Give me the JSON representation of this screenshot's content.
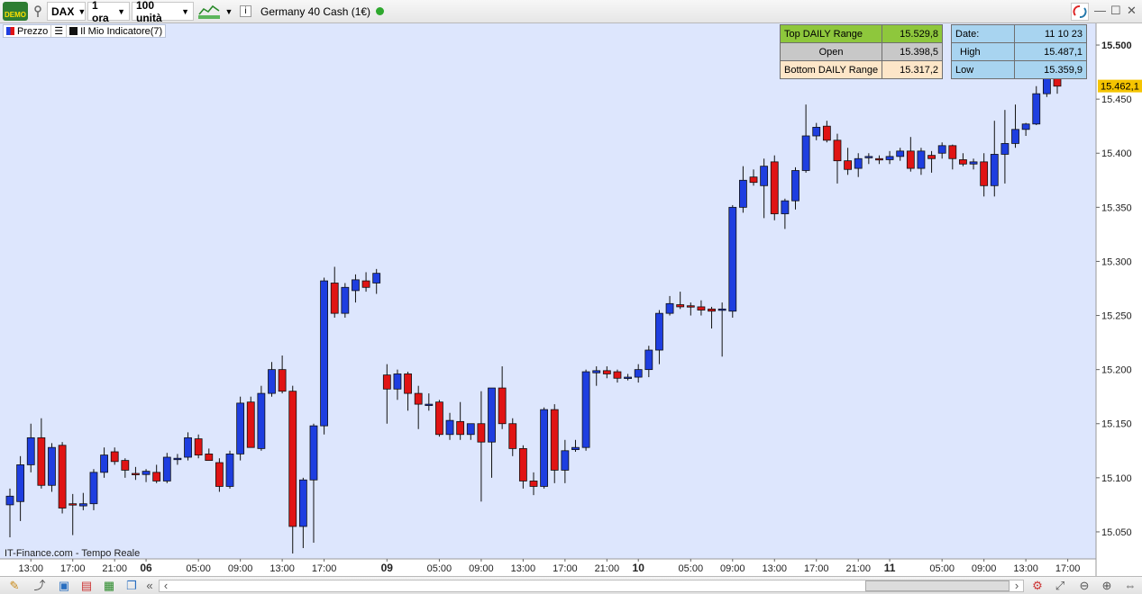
{
  "toolbar": {
    "demo_label": "DEMO",
    "symbol": "DAX",
    "timeframe": "1 ora",
    "units": "100 unità",
    "instrument": "Germany 40 Cash (1€)",
    "info_icon": "i"
  },
  "legend": {
    "price_label": "Prezzo",
    "indicator_label": "Il Mio Indicatore(7)"
  },
  "range_box": {
    "rows": [
      {
        "label": "Top DAILY Range",
        "value": "15.529,8"
      },
      {
        "label": "Open",
        "value": "15.398,5"
      },
      {
        "label": "Bottom DAILY Range",
        "value": "15.317,2"
      }
    ]
  },
  "stats_box": {
    "rows": [
      {
        "label": "Date:",
        "value": "11 10 23"
      },
      {
        "label": "High",
        "value": "15.487,1"
      },
      {
        "label": "Low",
        "value": "15.359,9"
      }
    ]
  },
  "watermark": "IT-Finance.com - Tempo Reale",
  "colors": {
    "up": "#1e3ee0",
    "down": "#e01414",
    "background": "#dde6fd",
    "last_price": "#f5c400"
  },
  "chart_data": {
    "type": "candlestick",
    "ylim": [
      15025,
      15520
    ],
    "y_ticks": [
      "15.500",
      "15.450",
      "15.400",
      "15.350",
      "15.300",
      "15.250",
      "15.200",
      "15.150",
      "15.100",
      "15.050"
    ],
    "y_tick_values": [
      15500,
      15450,
      15400,
      15350,
      15300,
      15250,
      15200,
      15150,
      15100,
      15050
    ],
    "last_price": "15.462,1",
    "last_price_value": 15462.1,
    "x_ticks": [
      {
        "label": "13:00",
        "bar": 2,
        "bold": false
      },
      {
        "label": "17:00",
        "bar": 6,
        "bold": false
      },
      {
        "label": "21:00",
        "bar": 10,
        "bold": false
      },
      {
        "label": "06",
        "bar": 13,
        "bold": true
      },
      {
        "label": "05:00",
        "bar": 18,
        "bold": false
      },
      {
        "label": "09:00",
        "bar": 22,
        "bold": false
      },
      {
        "label": "13:00",
        "bar": 26,
        "bold": false
      },
      {
        "label": "17:00",
        "bar": 30,
        "bold": false
      },
      {
        "label": "09",
        "bar": 36,
        "bold": true
      },
      {
        "label": "05:00",
        "bar": 41,
        "bold": false
      },
      {
        "label": "09:00",
        "bar": 45,
        "bold": false
      },
      {
        "label": "13:00",
        "bar": 49,
        "bold": false
      },
      {
        "label": "17:00",
        "bar": 53,
        "bold": false
      },
      {
        "label": "21:00",
        "bar": 57,
        "bold": false
      },
      {
        "label": "10",
        "bar": 60,
        "bold": true
      },
      {
        "label": "05:00",
        "bar": 65,
        "bold": false
      },
      {
        "label": "09:00",
        "bar": 69,
        "bold": false
      },
      {
        "label": "13:00",
        "bar": 73,
        "bold": false
      },
      {
        "label": "17:00",
        "bar": 77,
        "bold": false
      },
      {
        "label": "21:00",
        "bar": 81,
        "bold": false
      },
      {
        "label": "11",
        "bar": 84,
        "bold": true
      },
      {
        "label": "05:00",
        "bar": 89,
        "bold": false
      },
      {
        "label": "09:00",
        "bar": 93,
        "bold": false
      },
      {
        "label": "13:00",
        "bar": 97,
        "bold": false
      },
      {
        "label": "17:00",
        "bar": 101,
        "bold": false
      }
    ],
    "candles": [
      {
        "o": 15075,
        "h": 15090,
        "l": 15045,
        "c": 15083
      },
      {
        "o": 15078,
        "h": 15120,
        "l": 15060,
        "c": 15112
      },
      {
        "o": 15112,
        "h": 15150,
        "l": 15105,
        "c": 15137
      },
      {
        "o": 15137,
        "h": 15155,
        "l": 15090,
        "c": 15093
      },
      {
        "o": 15093,
        "h": 15132,
        "l": 15087,
        "c": 15128
      },
      {
        "o": 15130,
        "h": 15133,
        "l": 15067,
        "c": 15072
      },
      {
        "o": 15076,
        "h": 15085,
        "l": 15047,
        "c": 15075
      },
      {
        "o": 15074,
        "h": 15086,
        "l": 15070,
        "c": 15076
      },
      {
        "o": 15076,
        "h": 15108,
        "l": 15070,
        "c": 15105
      },
      {
        "o": 15105,
        "h": 15128,
        "l": 15100,
        "c": 15121
      },
      {
        "o": 15124,
        "h": 15128,
        "l": 15112,
        "c": 15115
      },
      {
        "o": 15116,
        "h": 15118,
        "l": 15100,
        "c": 15107
      },
      {
        "o": 15104,
        "h": 15110,
        "l": 15098,
        "c": 15103
      },
      {
        "o": 15103,
        "h": 15108,
        "l": 15096,
        "c": 15106
      },
      {
        "o": 15105,
        "h": 15112,
        "l": 15095,
        "c": 15097
      },
      {
        "o": 15097,
        "h": 15123,
        "l": 15095,
        "c": 15119
      },
      {
        "o": 15118,
        "h": 15122,
        "l": 15112,
        "c": 15118
      },
      {
        "o": 15119,
        "h": 15142,
        "l": 15116,
        "c": 15137
      },
      {
        "o": 15136,
        "h": 15140,
        "l": 15118,
        "c": 15121
      },
      {
        "o": 15122,
        "h": 15127,
        "l": 15116,
        "c": 15116
      },
      {
        "o": 15114,
        "h": 15118,
        "l": 15087,
        "c": 15092
      },
      {
        "o": 15092,
        "h": 15125,
        "l": 15090,
        "c": 15122
      },
      {
        "o": 15122,
        "h": 15175,
        "l": 15116,
        "c": 15169
      },
      {
        "o": 15170,
        "h": 15175,
        "l": 15128,
        "c": 15128
      },
      {
        "o": 15127,
        "h": 15185,
        "l": 15125,
        "c": 15178
      },
      {
        "o": 15178,
        "h": 15207,
        "l": 15175,
        "c": 15200
      },
      {
        "o": 15200,
        "h": 15213,
        "l": 15178,
        "c": 15180
      },
      {
        "o": 15180,
        "h": 15185,
        "l": 15030,
        "c": 15055
      },
      {
        "o": 15055,
        "h": 15100,
        "l": 15035,
        "c": 15098
      },
      {
        "o": 15098,
        "h": 15150,
        "l": 15040,
        "c": 15148
      },
      {
        "o": 15148,
        "h": 15285,
        "l": 15140,
        "c": 15282
      },
      {
        "o": 15280,
        "h": 15295,
        "l": 15248,
        "c": 15252
      },
      {
        "o": 15252,
        "h": 15280,
        "l": 15248,
        "c": 15276
      },
      {
        "o": 15273,
        "h": 15288,
        "l": 15262,
        "c": 15283
      },
      {
        "o": 15282,
        "h": 15290,
        "l": 15272,
        "c": 15276
      },
      {
        "o": 15280,
        "h": 15293,
        "l": 15270,
        "c": 15289
      },
      {
        "o": 15195,
        "h": 15205,
        "l": 15150,
        "c": 15182
      },
      {
        "o": 15182,
        "h": 15200,
        "l": 15172,
        "c": 15196
      },
      {
        "o": 15196,
        "h": 15198,
        "l": 15162,
        "c": 15178
      },
      {
        "o": 15178,
        "h": 15185,
        "l": 15145,
        "c": 15168
      },
      {
        "o": 15168,
        "h": 15178,
        "l": 15162,
        "c": 15168
      },
      {
        "o": 15170,
        "h": 15172,
        "l": 15138,
        "c": 15140
      },
      {
        "o": 15140,
        "h": 15160,
        "l": 15135,
        "c": 15153
      },
      {
        "o": 15152,
        "h": 15170,
        "l": 15135,
        "c": 15140
      },
      {
        "o": 15140,
        "h": 15150,
        "l": 15135,
        "c": 15150
      },
      {
        "o": 15150,
        "h": 15180,
        "l": 15078,
        "c": 15133
      },
      {
        "o": 15133,
        "h": 15183,
        "l": 15100,
        "c": 15183
      },
      {
        "o": 15183,
        "h": 15203,
        "l": 15145,
        "c": 15150
      },
      {
        "o": 15150,
        "h": 15155,
        "l": 15120,
        "c": 15127
      },
      {
        "o": 15127,
        "h": 15130,
        "l": 15090,
        "c": 15097
      },
      {
        "o": 15097,
        "h": 15105,
        "l": 15084,
        "c": 15092
      },
      {
        "o": 15092,
        "h": 15165,
        "l": 15090,
        "c": 15163
      },
      {
        "o": 15163,
        "h": 15168,
        "l": 15095,
        "c": 15107
      },
      {
        "o": 15107,
        "h": 15135,
        "l": 15095,
        "c": 15125
      },
      {
        "o": 15126,
        "h": 15135,
        "l": 15124,
        "c": 15128
      },
      {
        "o": 15128,
        "h": 15200,
        "l": 15125,
        "c": 15198
      },
      {
        "o": 15197,
        "h": 15203,
        "l": 15185,
        "c": 15199
      },
      {
        "o": 15199,
        "h": 15203,
        "l": 15192,
        "c": 15196
      },
      {
        "o": 15198,
        "h": 15200,
        "l": 15188,
        "c": 15192
      },
      {
        "o": 15192,
        "h": 15196,
        "l": 15190,
        "c": 15193
      },
      {
        "o": 15193,
        "h": 15205,
        "l": 15188,
        "c": 15200
      },
      {
        "o": 15200,
        "h": 15222,
        "l": 15193,
        "c": 15218
      },
      {
        "o": 15218,
        "h": 15255,
        "l": 15205,
        "c": 15252
      },
      {
        "o": 15252,
        "h": 15268,
        "l": 15250,
        "c": 15261
      },
      {
        "o": 15260,
        "h": 15272,
        "l": 15256,
        "c": 15258
      },
      {
        "o": 15259,
        "h": 15262,
        "l": 15250,
        "c": 15258
      },
      {
        "o": 15258,
        "h": 15264,
        "l": 15250,
        "c": 15255
      },
      {
        "o": 15256,
        "h": 15258,
        "l": 15238,
        "c": 15254
      },
      {
        "o": 15255,
        "h": 15262,
        "l": 15212,
        "c": 15256
      },
      {
        "o": 15254,
        "h": 15352,
        "l": 15248,
        "c": 15350
      },
      {
        "o": 15350,
        "h": 15388,
        "l": 15345,
        "c": 15375
      },
      {
        "o": 15378,
        "h": 15385,
        "l": 15370,
        "c": 15373
      },
      {
        "o": 15370,
        "h": 15395,
        "l": 15340,
        "c": 15388
      },
      {
        "o": 15392,
        "h": 15398,
        "l": 15338,
        "c": 15344
      },
      {
        "o": 15344,
        "h": 15358,
        "l": 15330,
        "c": 15356
      },
      {
        "o": 15356,
        "h": 15387,
        "l": 15348,
        "c": 15384
      },
      {
        "o": 15384,
        "h": 15445,
        "l": 15382,
        "c": 15416
      },
      {
        "o": 15416,
        "h": 15428,
        "l": 15412,
        "c": 15424
      },
      {
        "o": 15425,
        "h": 15430,
        "l": 15410,
        "c": 15412
      },
      {
        "o": 15412,
        "h": 15418,
        "l": 15372,
        "c": 15393
      },
      {
        "o": 15393,
        "h": 15405,
        "l": 15380,
        "c": 15385
      },
      {
        "o": 15386,
        "h": 15400,
        "l": 15378,
        "c": 15395
      },
      {
        "o": 15396,
        "h": 15400,
        "l": 15390,
        "c": 15397
      },
      {
        "o": 15395,
        "h": 15398,
        "l": 15390,
        "c": 15394
      },
      {
        "o": 15394,
        "h": 15402,
        "l": 15390,
        "c": 15397
      },
      {
        "o": 15397,
        "h": 15405,
        "l": 15393,
        "c": 15402
      },
      {
        "o": 15402,
        "h": 15415,
        "l": 15383,
        "c": 15386
      },
      {
        "o": 15386,
        "h": 15405,
        "l": 15380,
        "c": 15402
      },
      {
        "o": 15398,
        "h": 15402,
        "l": 15382,
        "c": 15395
      },
      {
        "o": 15400,
        "h": 15410,
        "l": 15395,
        "c": 15407
      },
      {
        "o": 15407,
        "h": 15408,
        "l": 15385,
        "c": 15395
      },
      {
        "o": 15394,
        "h": 15400,
        "l": 15388,
        "c": 15390
      },
      {
        "o": 15390,
        "h": 15395,
        "l": 15385,
        "c": 15392
      },
      {
        "o": 15392,
        "h": 15400,
        "l": 15360,
        "c": 15370
      },
      {
        "o": 15370,
        "h": 15430,
        "l": 15360,
        "c": 15399
      },
      {
        "o": 15399,
        "h": 15440,
        "l": 15372,
        "c": 15409
      },
      {
        "o": 15409,
        "h": 15445,
        "l": 15405,
        "c": 15422
      },
      {
        "o": 15422,
        "h": 15428,
        "l": 15416,
        "c": 15427
      },
      {
        "o": 15427,
        "h": 15462,
        "l": 15426,
        "c": 15455
      },
      {
        "o": 15455,
        "h": 15480,
        "l": 15452,
        "c": 15472
      },
      {
        "o": 15472,
        "h": 15487,
        "l": 15455,
        "c": 15462
      }
    ]
  }
}
